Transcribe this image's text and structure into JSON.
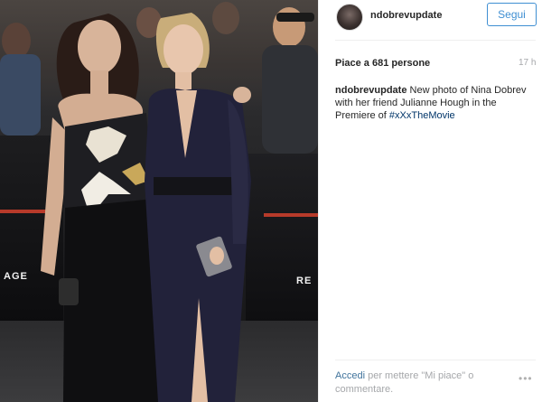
{
  "photo": {
    "alt": "Nina Dobrev and Julianne Hough at the premiere",
    "sign_left": "AGE",
    "sign_right": "RE"
  },
  "header": {
    "username": "ndobrevupdate",
    "follow_label": "Segui"
  },
  "stats": {
    "likes": "Piace a 681 persone",
    "time": "17 h"
  },
  "caption": {
    "username": "ndobrevupdate",
    "text": " New photo of Nina Dobrev with her friend Julianne Hough in the Premiere of ",
    "hashtag": "#xXxTheMovie"
  },
  "footer": {
    "login_link": "Accedi",
    "rest": " per mettere \"Mi piace\" o commentare."
  },
  "colors": {
    "accent": "#3f8fd2",
    "hashtag": "#003569",
    "muted": "#a5a7aa"
  },
  "icons": {
    "more": "more-options-icon"
  }
}
